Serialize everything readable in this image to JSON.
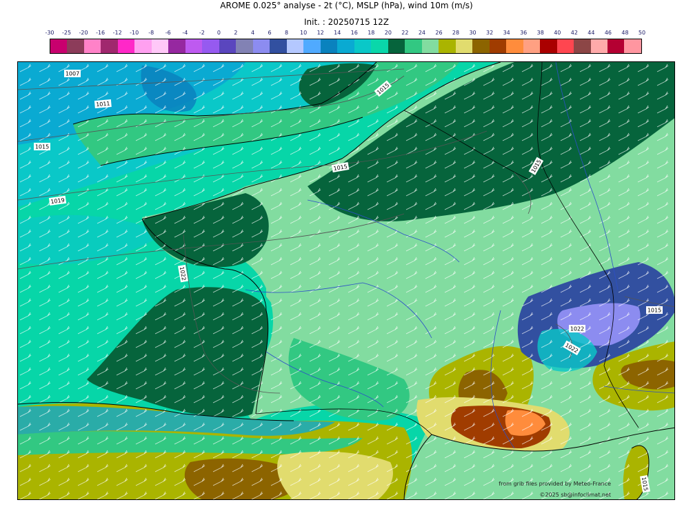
{
  "title": "AROME 0.025° analyse - 2t (°C), MSLP (hPa), wind 10m (m/s)",
  "init": "Init. : 20250715 12Z",
  "legend": {
    "ticks": [
      "-30",
      "-25",
      "-20",
      "-16",
      "-12",
      "-10",
      "-8",
      "-6",
      "-4",
      "-2",
      "0",
      "2",
      "4",
      "6",
      "8",
      "10",
      "12",
      "14",
      "16",
      "18",
      "20",
      "22",
      "24",
      "26",
      "28",
      "30",
      "32",
      "34",
      "36",
      "38",
      "40",
      "42",
      "44",
      "46",
      "48",
      "50"
    ],
    "colors": [
      "#c8006e",
      "#8c3c5a",
      "#ff82c8",
      "#a0286e",
      "#ff28c8",
      "#ffa0f0",
      "#ffc8f8",
      "#9628a0",
      "#be5af0",
      "#965af0",
      "#5a46be",
      "#8282b4",
      "#8c8cf0",
      "#3250a0",
      "#b4c8ff",
      "#50aaff",
      "#0a82be",
      "#0aaad2",
      "#0ac8c8",
      "#0ad7aa",
      "#06643c",
      "#32c882",
      "#82dca0",
      "#aab400",
      "#e1dc6e",
      "#8c6400",
      "#a03c00",
      "#ff8c3c",
      "#ffa082",
      "#aa0000",
      "#ff4650",
      "#8c4646",
      "#ffaaaa",
      "#b40032",
      "#ff96a0"
    ]
  },
  "colors": {
    "sea": "#07d6a8",
    "sea_cool": "#0ac8c8",
    "sea_cold": "#0aaad2",
    "sea_coldest": "#0a82be",
    "land_22": "#06643c",
    "land_24": "#32c882",
    "land_26": "#82dca0",
    "land_28": "#aab400",
    "land_30": "#e1dc6e",
    "land_32": "#8c6400",
    "land_34": "#a03c00",
    "land_36": "#ff8c3c",
    "mountain_cold": "#3250a0",
    "mountain_cool": "#8c8cf0"
  },
  "isobars": [
    "1007",
    "1011",
    "1015",
    "1015",
    "1015",
    "1019",
    "1022",
    "1015",
    "1015",
    "1022",
    "1022",
    "1015"
  ],
  "credits": {
    "source": "from grib files provided by Meteo-France",
    "copyright": "©2025 sb@infoclimat.net"
  }
}
